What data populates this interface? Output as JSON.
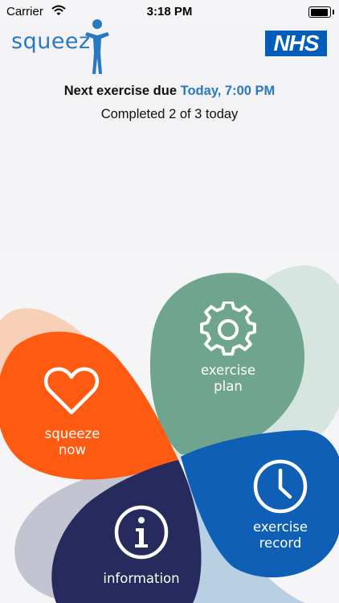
{
  "status_bar": {
    "carrier": "Carrier",
    "time": "3:18 PM"
  },
  "header": {
    "logo_text": "squeez",
    "nhs_badge": "NHS",
    "next_label": "Next exercise due",
    "next_due": "Today, 7:00 PM",
    "completed": "Completed 2 of 3 today"
  },
  "tiles": {
    "squeeze_now": {
      "line1": "squeeze",
      "line2": "now",
      "icon": "heart-icon",
      "color": "#ff5a12"
    },
    "exercise_plan": {
      "line1": "exercise",
      "line2": "plan",
      "icon": "gear-icon",
      "color": "#6fa58f"
    },
    "exercise_record": {
      "line1": "exercise",
      "line2": "record",
      "icon": "clock-icon",
      "color": "#0e5fb5"
    },
    "information": {
      "line1": "information",
      "icon": "info-icon",
      "color": "#262a5c"
    }
  },
  "colors": {
    "brand_blue": "#2a79c0",
    "nhs_blue": "#005eb8"
  }
}
